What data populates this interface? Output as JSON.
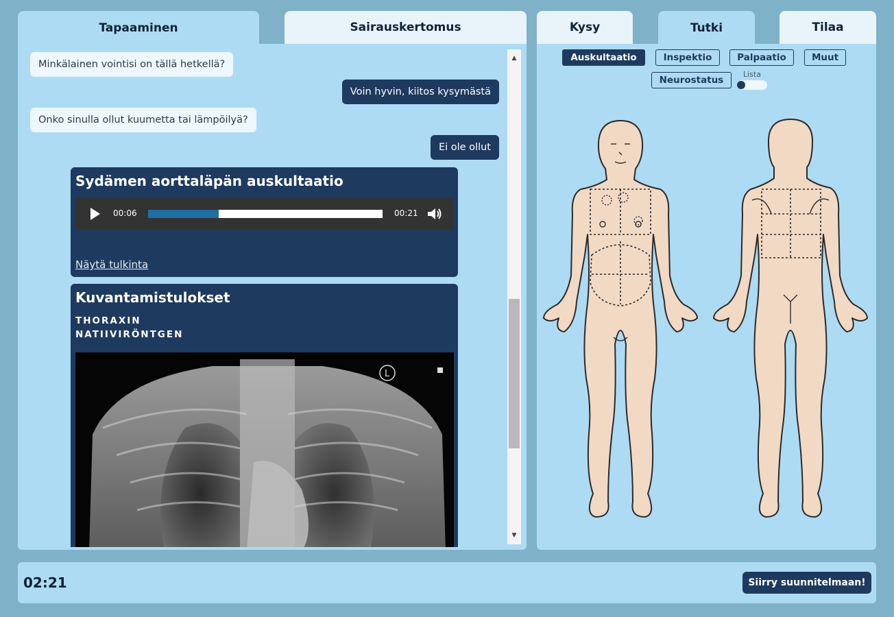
{
  "left_tabs": {
    "tapaaminen": "Tapaaminen",
    "sairauskertomus": "Sairauskertomus"
  },
  "chat": [
    {
      "role": "q",
      "text": "Minkälainen vointisi on tällä hetkellä?"
    },
    {
      "role": "a",
      "text": "Voin hyvin, kiitos kysymästä"
    },
    {
      "role": "q",
      "text": "Onko sinulla ollut kuumetta tai lämpöilyä?"
    },
    {
      "role": "a",
      "text": "Ei ole ollut"
    }
  ],
  "audio_card": {
    "title": "Sydämen aorttaläpän auskultaatio",
    "current_time": "00:06",
    "duration": "00:21",
    "progress_fraction": 0.3,
    "link": "Näytä tulkinta"
  },
  "imaging_card": {
    "title": "Kuvantamistulokset",
    "subtitle_1": "THORAXIN",
    "subtitle_2": "NATIIVIRÖNTGEN",
    "marker": "L"
  },
  "right_tabs": {
    "kysy": "Kysy",
    "tutki": "Tutki",
    "tilaa": "Tilaa"
  },
  "exam_buttons": {
    "auskultaatio": "Auskultaatio",
    "inspektio": "Inspektio",
    "palpaatio": "Palpaatio",
    "muut": "Muut",
    "neurostatus": "Neurostatus"
  },
  "lista_label": "Lista",
  "bottom": {
    "timer": "02:21",
    "next": "Siirry suunnitelmaan!"
  },
  "colors": {
    "navy": "#1e3a5f",
    "panel": "#addbf3",
    "background": "#7fb1c9",
    "skin": "#f2d9c4"
  }
}
